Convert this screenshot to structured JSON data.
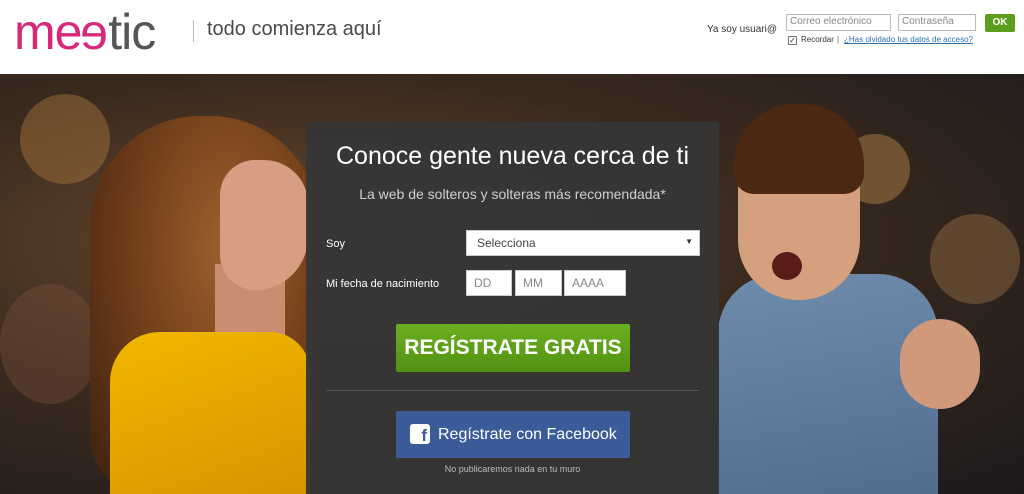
{
  "header": {
    "logo": {
      "part1": "me",
      "part2": "e",
      "part3": "tic"
    },
    "tagline": "todo comienza aquí",
    "login": {
      "label": "Ya soy usuari@",
      "email_placeholder": "Correo electrónico",
      "password_placeholder": "Contraseña",
      "ok_label": "OK",
      "remember_label": "Recordar",
      "remember_checked": true,
      "separator": "|",
      "forgot_link": "¿Has olvidado tus datos de acceso?"
    }
  },
  "registration": {
    "title": "Conoce gente nueva cerca de ti",
    "subtitle": "La web de solteros y solteras más recomendada*",
    "gender_label": "Soy",
    "gender_select_value": "Selecciona",
    "birth_label": "Mi fecha de nacimiento",
    "day_placeholder": "DD",
    "month_placeholder": "MM",
    "year_placeholder": "AAAA",
    "register_button": "REGÍSTRATE GRATIS",
    "facebook_button": "Regístrate con Facebook",
    "facebook_icon_glyph": "f",
    "facebook_note": "No publicaremos nada en tu muro"
  },
  "colors": {
    "brand_pink": "#d8287a",
    "register_green": "#5a9e1c",
    "facebook_blue": "#3b5b99",
    "panel_bg": "#363636"
  }
}
